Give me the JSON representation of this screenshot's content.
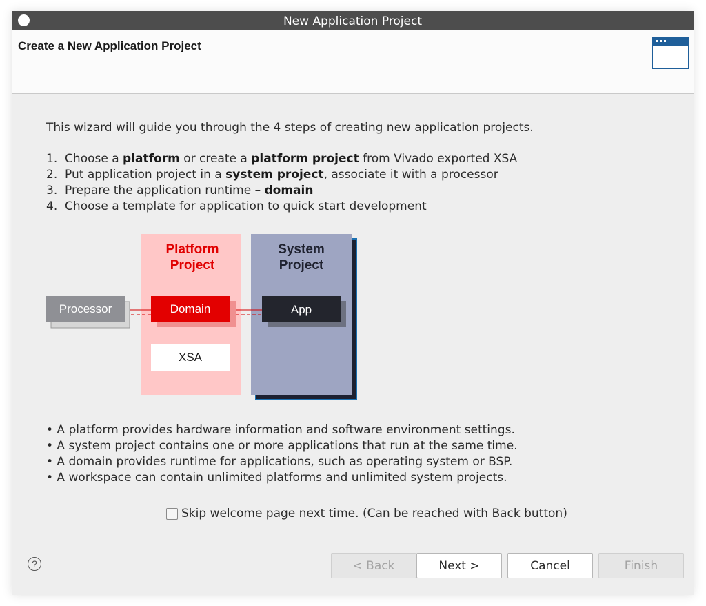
{
  "window": {
    "title": "New Application Project"
  },
  "banner": {
    "title": "Create a New Application Project",
    "icon": "wizard-window-icon"
  },
  "intro": "This wizard will guide you through the 4 steps of creating new application projects.",
  "steps": [
    {
      "n": "1.",
      "t1": "Choose a ",
      "b1": "platform",
      "t2": " or create a ",
      "b2": "platform project",
      "t3": " from Vivado exported XSA"
    },
    {
      "n": "2.",
      "t1": "Put application project in a ",
      "b1": "system project",
      "t2": ", associate it with a processor"
    },
    {
      "n": "3.",
      "t1": "Prepare the application runtime – ",
      "b1": "domain"
    },
    {
      "n": "4.",
      "t1": "Choose a template for application to quick start development"
    }
  ],
  "diagram": {
    "platform_line1": "Platform",
    "platform_line2": "Project",
    "system_line1": "System",
    "system_line2": "Project",
    "processor": "Processor",
    "domain": "Domain",
    "xsa": "XSA",
    "app": "App",
    "colors": {
      "platform_bg": "#ffc7c7",
      "platform_text": "#e00000",
      "domain": "#e30000",
      "system_bg": "#9ea5c2",
      "system_shadow": "#1d2030",
      "system_edge": "#1a6fb0",
      "app": "#23252d",
      "processor": "#8f9095"
    }
  },
  "bullets": [
    "• A platform provides hardware information and software environment settings.",
    "• A system project contains one or more applications that run at the same time.",
    "• A domain provides runtime for applications, such as operating system or BSP.",
    "• A workspace can contain unlimited platforms and unlimited system projects."
  ],
  "skip_checkbox": {
    "label": "Skip welcome page next time. (Can be reached with Back button)",
    "checked": false
  },
  "buttons": {
    "help": "?",
    "back": "< Back",
    "next": "Next >",
    "cancel": "Cancel",
    "finish": "Finish"
  }
}
